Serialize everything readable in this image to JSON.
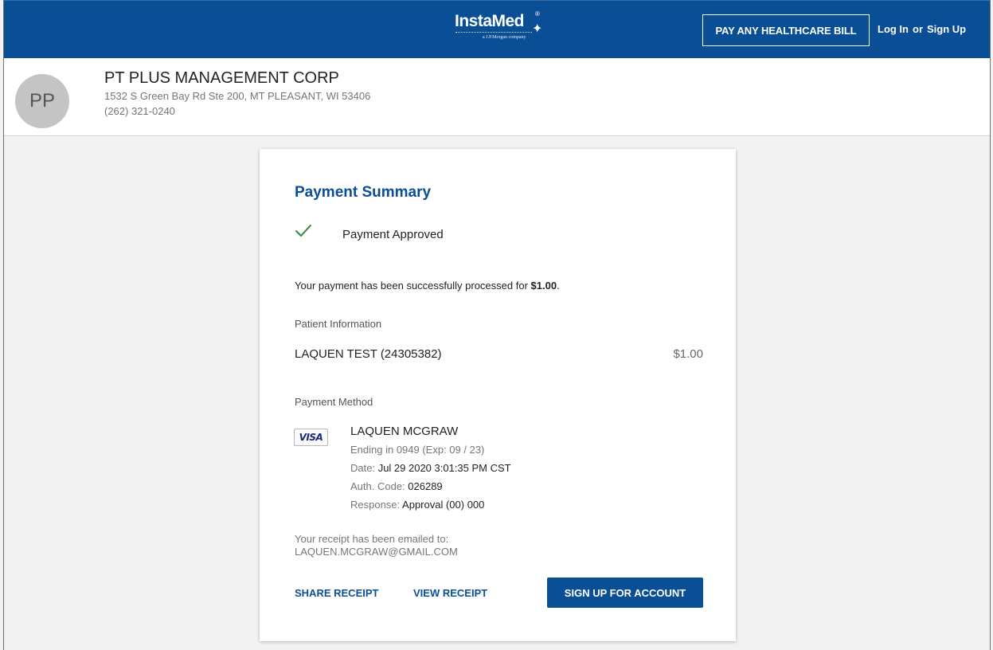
{
  "header": {
    "logo_text": "InstaMed",
    "logo_sub": "a J.P.Morgan company",
    "pay_button": "PAY ANY HEALTHCARE BILL",
    "login": "Log In",
    "or": "or",
    "signup": "Sign Up"
  },
  "merchant": {
    "initials": "PP",
    "name": "PT PLUS MANAGEMENT CORP",
    "address": "1532 S Green Bay Rd Ste 200, MT PLEASANT, WI 53406",
    "phone": "(262) 321-0240"
  },
  "summary": {
    "title": "Payment Summary",
    "status": "Payment Approved",
    "processed_text": "Your payment has been successfully processed for ",
    "processed_amount": "$1.00",
    "patient_label": "Patient Information",
    "patient_name": "LAQUEN TEST (24305382)",
    "patient_amount": "$1.00",
    "method_label": "Payment Method",
    "card_brand": "VISA",
    "cardholder": "LAQUEN MCGRAW",
    "ending": "Ending in 0949 (Exp: 09 / 23)",
    "date_label": "Date: ",
    "date_value": "Jul 29 2020 3:01:35 PM CST",
    "auth_label": "Auth. Code: ",
    "auth_value": "026289",
    "response_label": "Response: ",
    "response_value": "Approval (00) 000",
    "receipt_emailed": "Your receipt has been emailed to:",
    "email": "LAQUEN.MCGRAW@GMAIL.COM",
    "share_receipt": "SHARE RECEIPT",
    "view_receipt": "VIEW RECEIPT",
    "signup_account": "SIGN UP FOR ACCOUNT"
  },
  "colors": {
    "brand": "#0a4f96",
    "success": "#2e8b3a"
  }
}
